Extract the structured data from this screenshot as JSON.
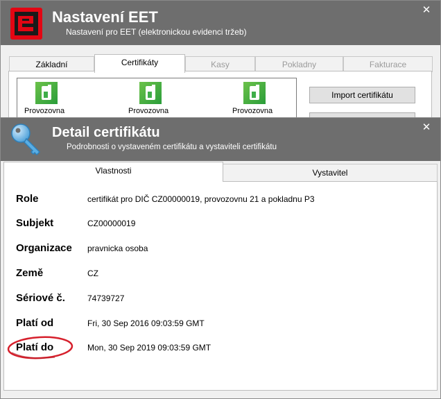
{
  "back_window": {
    "title": "Nastavení EET",
    "subtitle": "Nastavení pro EET (elektronickou evidenci tržeb)",
    "close_glyph": "✕",
    "tabs": [
      {
        "label": "Základní",
        "active": false,
        "enabled": true
      },
      {
        "label": "Certifikáty",
        "active": true,
        "enabled": true
      },
      {
        "label": "Kasy",
        "active": false,
        "enabled": false
      },
      {
        "label": "Pokladny",
        "active": false,
        "enabled": false
      },
      {
        "label": "Fakturace",
        "active": false,
        "enabled": false
      }
    ],
    "certificates": [
      {
        "label": "Provozovna",
        "icon": "certificate-icon"
      },
      {
        "label": "Provozovna",
        "icon": "certificate-icon"
      },
      {
        "label": "Provozovna",
        "icon": "certificate-icon"
      }
    ],
    "import_button": "Import certifikátu",
    "logo_icon": "eet-logo-icon",
    "logo_color": "#e30613"
  },
  "detail_window": {
    "title": "Detail certifikátu",
    "subtitle": "Podrobnosti o vystaveném certifikátu a vystaviteli certifikátu",
    "close_glyph": "✕",
    "header_icon": "key-icon",
    "tabs": [
      {
        "label": "Vlastnosti",
        "active": true
      },
      {
        "label": "Vystavitel",
        "active": false
      }
    ],
    "properties": [
      {
        "label": "Role",
        "value": "certifikát pro DIČ CZ00000019, provozovnu 21 a pokladnu P3"
      },
      {
        "label": "Subjekt",
        "value": "CZ00000019"
      },
      {
        "label": "Organizace",
        "value": "pravnicka osoba"
      },
      {
        "label": "Země",
        "value": "CZ"
      },
      {
        "label": "Sériové č.",
        "value": "74739727"
      },
      {
        "label": "Platí od",
        "value": "Fri, 30 Sep 2016 09:03:59 GMT"
      },
      {
        "label": "Platí do",
        "value": "Mon, 30 Sep 2019 09:03:59 GMT"
      }
    ],
    "highlighted_row": "Platí do",
    "highlight_color": "#d6202c"
  },
  "colors": {
    "header_bg": "#6e6e6e",
    "cert_icon_green": "#3fae49"
  }
}
